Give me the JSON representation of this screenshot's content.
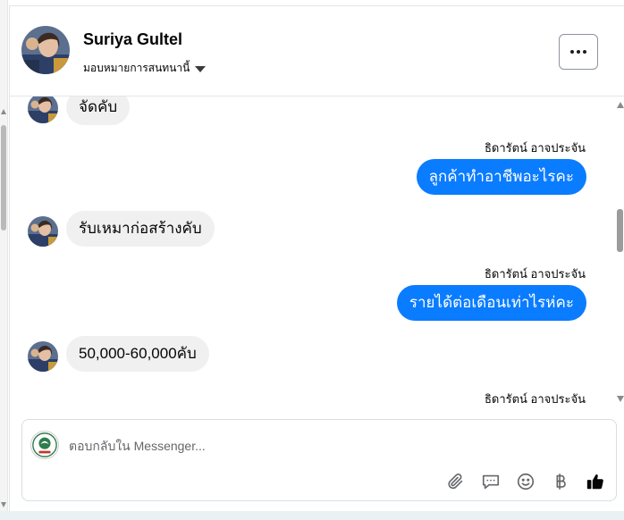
{
  "header": {
    "contact_name": "Suriya Gultel",
    "assign_label": "มอบหมายการสนทนานี้"
  },
  "thread": {
    "messages": [
      {
        "direction": "in",
        "text": "จัดคับ"
      },
      {
        "direction": "out",
        "sender": "ธิดารัตน์ อาจประจัน",
        "text": "ลูกค้าทำอาชีพอะไรคะ"
      },
      {
        "direction": "in",
        "text": "รับเหมาก่อสร้างคับ"
      },
      {
        "direction": "out",
        "sender": "ธิดารัตน์ อาจประจัน",
        "text": "รายได้ต่อเดือนเท่าไรห่คะ"
      },
      {
        "direction": "in",
        "text": "50,000-60,000คับ"
      },
      {
        "direction": "out",
        "sender": "ธิดารัตน์ อาจประจัน"
      }
    ]
  },
  "composer": {
    "placeholder": "ตอบกลับใน Messenger..."
  },
  "colors": {
    "outgoing_bubble": "#0a7cff",
    "incoming_bubble": "#f0f0f0",
    "like_icon": "#050505"
  },
  "icons": [
    "more-icon",
    "caret-down-icon",
    "attachment-icon",
    "saved-reply-icon",
    "emoji-icon",
    "baht-icon",
    "like-icon"
  ]
}
